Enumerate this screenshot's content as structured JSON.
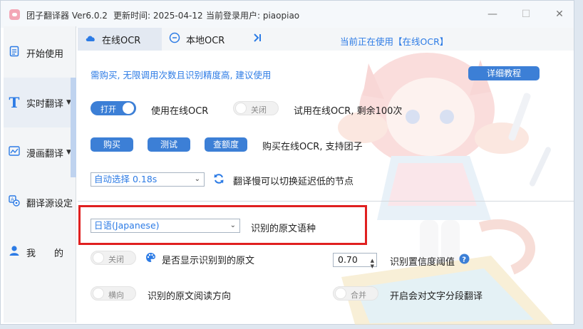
{
  "titlebar": {
    "app_name": "团子翻译器 Ver6.0.2",
    "update_time": "更新时间: 2025-04-12",
    "login_user": "当前登录用户: piaopiao",
    "minimize": "—",
    "maximize": "☐",
    "close": "✕"
  },
  "sidebar": {
    "items": [
      {
        "label": "开始使用",
        "icon": "document-icon"
      },
      {
        "label": "实时翻译",
        "icon": "text-t-icon"
      },
      {
        "label": "漫画翻译",
        "icon": "image-chart-icon"
      },
      {
        "label": "翻译源设定",
        "icon": "translate-settings-icon"
      },
      {
        "label": "我　　的",
        "icon": "user-icon"
      }
    ]
  },
  "tabs": {
    "online": "在线OCR",
    "local": "本地OCR",
    "current_use": "当前正在使用【在线OCR】"
  },
  "main": {
    "notice": "需购买, 无限调用次数且识别精度高, 建议使用",
    "tutorial_button": "详细教程",
    "use_online_toggle": "打开",
    "use_online_label": "使用在线OCR",
    "trial_toggle": "关闭",
    "trial_label": "试用在线OCR, 剩余100次",
    "buy_button": "购买",
    "test_button": "测试",
    "quota_button": "查额度",
    "buy_label": "购买在线OCR, 支持团子",
    "node_select": "自动选择  0.18s",
    "node_label": "翻译慢可以切换延迟低的节点",
    "language_select": "日语(Japanese)",
    "language_label": "识别的原文语种",
    "show_source_toggle": "关闭",
    "show_source_label": "是否显示识别到的原文",
    "confidence_value": "0.70",
    "confidence_label": "识别置信度阈值",
    "direction_toggle": "横向",
    "direction_label": "识别的原文阅读方向",
    "merge_toggle": "合并",
    "merge_label": "开启会对文字分段翻译"
  },
  "colors": {
    "accent": "#3c7fd6",
    "link_blue": "#2c7be5",
    "highlight_red": "#e02020"
  }
}
